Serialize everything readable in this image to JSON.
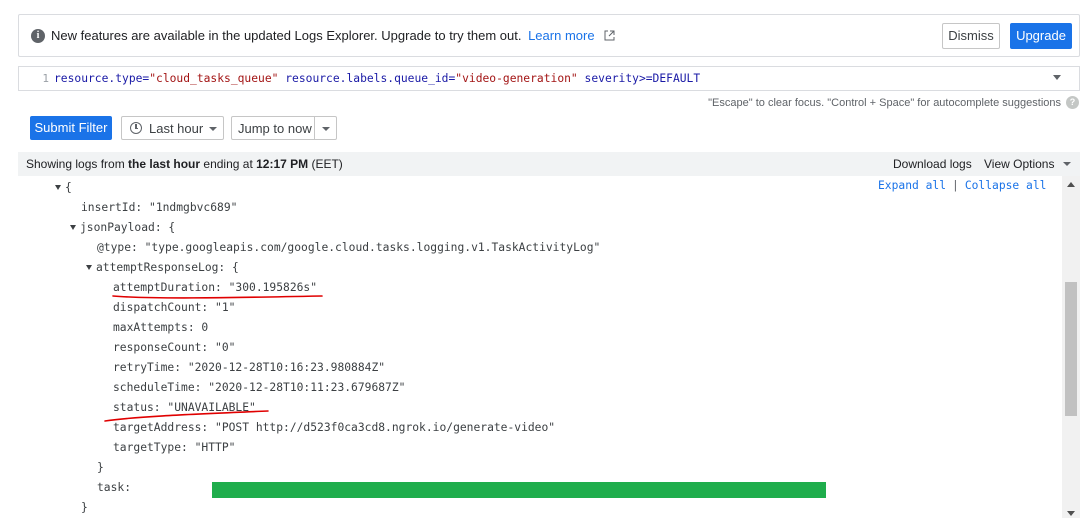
{
  "banner": {
    "info_icon": "info-icon",
    "message": "New features are available in the updated Logs Explorer. Upgrade to try them out.",
    "learn_more": "Learn more",
    "external_icon": "external-link-icon",
    "dismiss": "Dismiss",
    "upgrade": "Upgrade"
  },
  "editor": {
    "line_number": "1",
    "query": {
      "k1": "resource.type=",
      "v1": "\"cloud_tasks_queue\"",
      "k2": " resource.labels.queue_id=",
      "v2": "\"video-generation\"",
      "k3": " severity>=DEFAULT"
    }
  },
  "hint": "\"Escape\" to clear focus. \"Control + Space\" for autocomplete suggestions",
  "toolbar": {
    "submit": "Submit Filter",
    "time_range": "Last hour",
    "jump": "Jump to now"
  },
  "results": {
    "prefix": "Showing logs from ",
    "range": "the last hour",
    "middle": " ending at ",
    "time": "12:17 PM",
    "tz": " (EET)",
    "download": "Download logs",
    "view_options": "View Options"
  },
  "tree": {
    "expand_all": "Expand all",
    "separator": "|",
    "collapse_all": "Collapse all",
    "lines": [
      "{",
      "insertId: \"1ndmgbvc689\"",
      "jsonPayload: {",
      "@type: \"type.googleapis.com/google.cloud.tasks.logging.v1.TaskActivityLog\"",
      "attemptResponseLog: {",
      "attemptDuration: \"300.195826s\"",
      "dispatchCount: \"1\"",
      "maxAttempts: 0",
      "responseCount: \"0\"",
      "retryTime: \"2020-12-28T10:16:23.980884Z\"",
      "scheduleTime: \"2020-12-28T10:11:23.679687Z\"",
      "status: \"UNAVAILABLE\"",
      "targetAddress: \"POST http://d523f0ca3cd8.ngrok.io/generate-video\"",
      "targetType: \"HTTP\"",
      "}",
      "task:",
      "}"
    ]
  },
  "colors": {
    "primary": "#1a73e8",
    "redacted": "#1fad4c",
    "annotation": "#e00000"
  }
}
